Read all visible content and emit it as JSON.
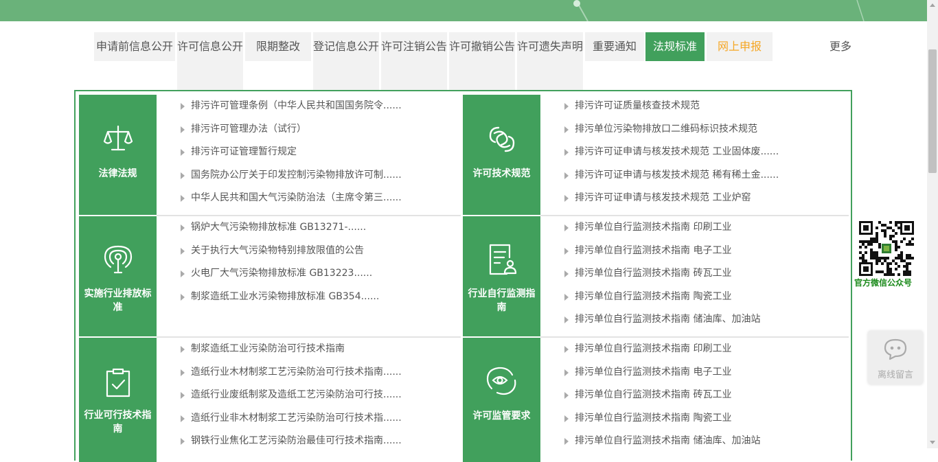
{
  "tabs": [
    {
      "label": "申请前信息公开"
    },
    {
      "label": "许可信息公开"
    },
    {
      "label": "限期整改"
    },
    {
      "label": "登记信息公开"
    },
    {
      "label": "许可注销公告"
    },
    {
      "label": "许可撤销公告"
    },
    {
      "label": "许可遗失声明"
    },
    {
      "label": "重要通知"
    },
    {
      "label": "法规标准"
    },
    {
      "label": "网上申报"
    }
  ],
  "more_label": "更多",
  "categories": [
    {
      "title": "法律法规",
      "icon": "scales-icon",
      "items": [
        "排污许可管理条例（中华人民共和国国务院令......",
        "排污许可管理办法（试行）",
        "排污许可证管理暂行规定",
        "国务院办公厅关于印发控制污染物排放许可制......",
        "中华人民共和国大气污染防治法（主席令第三......"
      ]
    },
    {
      "title": "许可技术规范",
      "icon": "link-icon",
      "items": [
        "排污许可证质量核查技术规范",
        "排污单位污染物排放口二维码标识技术规范",
        "排污许可证申请与核发技术规范 工业固体废......",
        "排污许可证申请与核发技术规范 稀有稀土金......",
        "排污许可证申请与核发技术规范 工业炉窑"
      ]
    },
    {
      "title": "实施行业排放标准",
      "icon": "location-signal-icon",
      "items": [
        "锅炉大气污染物排放标准 GB13271-......",
        "关于执行大气污染物特别排放限值的公告",
        "火电厂大气污染物排放标准 GB13223......",
        "制浆造纸工业水污染物排放标准 GB354......"
      ]
    },
    {
      "title": "行业自行监测指南",
      "icon": "document-person-icon",
      "items": [
        "排污单位自行监测技术指南 印刷工业",
        "排污单位自行监测技术指南 电子工业",
        "排污单位自行监测技术指南 砖瓦工业",
        "排污单位自行监测技术指南 陶瓷工业",
        "排污单位自行监测技术指南 储油库、加油站"
      ]
    },
    {
      "title": "行业可行技术指南",
      "icon": "clipboard-check-icon",
      "items": [
        "制浆造纸工业污染防治可行技术指南",
        "造纸行业木材制浆工艺污染防治可行技术指南......",
        "造纸行业废纸制浆及造纸工艺污染防治可行技......",
        "造纸行业非木材制浆工艺污染防治可行技术指......",
        "钢铁行业焦化工艺污染防治最佳可行技术指南......"
      ]
    },
    {
      "title": "许可监管要求",
      "icon": "eye-shield-icon",
      "items": [
        "排污单位自行监测技术指南 印刷工业",
        "排污单位自行监测技术指南 电子工业",
        "排污单位自行监测技术指南 砖瓦工业",
        "排污单位自行监测技术指南 陶瓷工业",
        "排污单位自行监测技术指南 储油库、加油站"
      ]
    }
  ],
  "qr_caption": "官方微信公众号",
  "chat_label": "离线留言",
  "colors": {
    "brand_green": "#41a05c",
    "banner_green": "#6ab27a",
    "tab_bg": "#f2f2f2",
    "online_orange": "#f5a623",
    "qr_caption": "#1a8a1a"
  }
}
